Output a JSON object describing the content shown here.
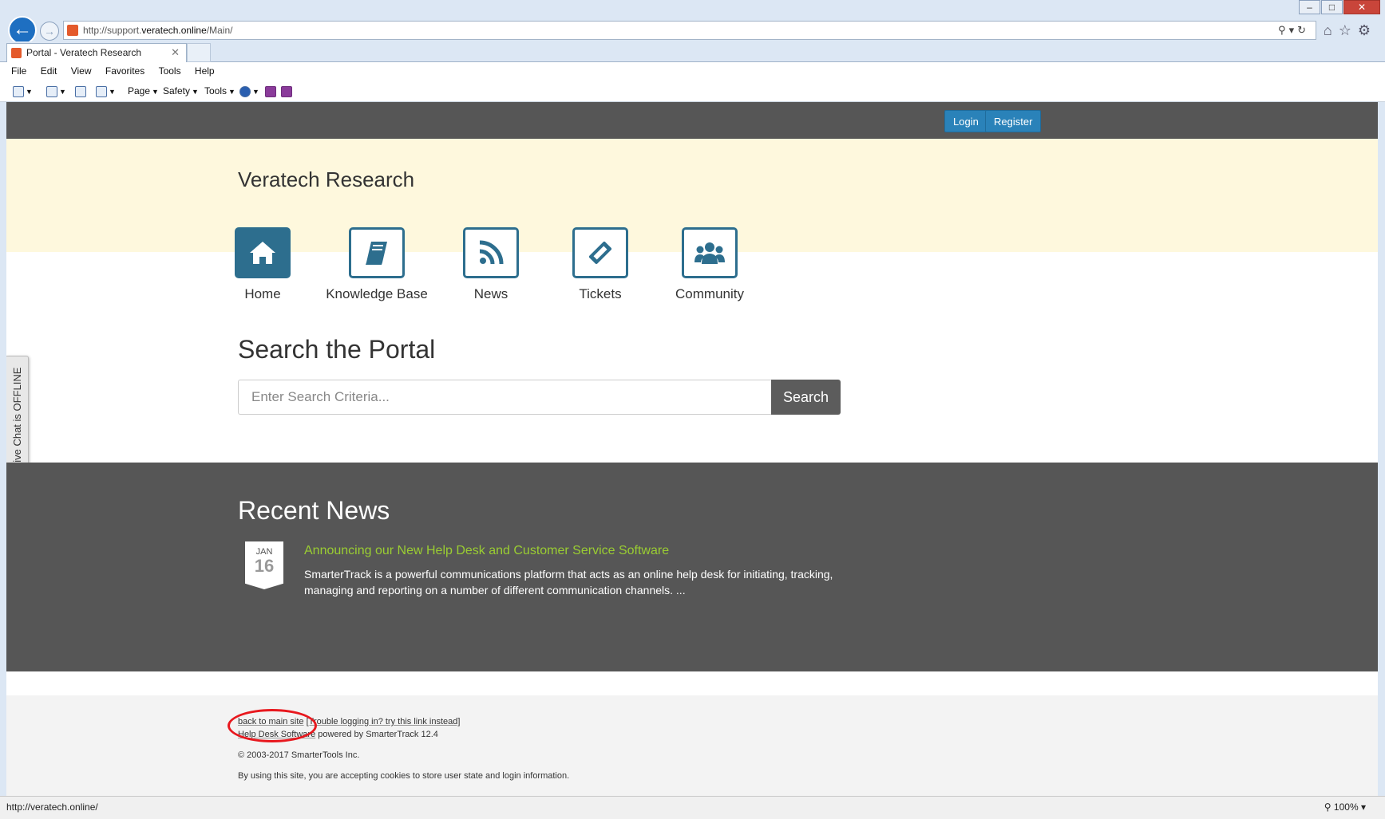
{
  "browser": {
    "url_prefix": "http://support.",
    "url_domain": "veratech.online",
    "url_path": "/Main/",
    "tab_title": "Portal - Veratech Research",
    "menu": [
      "File",
      "Edit",
      "View",
      "Favorites",
      "Tools",
      "Help"
    ],
    "cmd_page": "Page",
    "cmd_safety": "Safety",
    "cmd_tools": "Tools",
    "status_url": "http://veratech.online/",
    "zoom": "100%"
  },
  "header": {
    "login_label": "Login",
    "register_label": "Register"
  },
  "site_title": "Veratech Research",
  "nav_tiles": [
    {
      "label": "Home",
      "icon": "home-icon"
    },
    {
      "label": "Knowledge Base",
      "icon": "book-icon"
    },
    {
      "label": "News",
      "icon": "rss-icon"
    },
    {
      "label": "Tickets",
      "icon": "ticket-icon"
    },
    {
      "label": "Community",
      "icon": "users-icon"
    }
  ],
  "search": {
    "title": "Search the Portal",
    "placeholder": "Enter Search Criteria...",
    "button_label": "Search"
  },
  "live_chat": "Live Chat is OFFLINE",
  "news": {
    "title": "Recent News",
    "item": {
      "month": "JAN",
      "day": "16",
      "headline": "Announcing our New Help Desk and Customer Service Software",
      "summary": "SmarterTrack is a powerful communications platform that acts as an online help desk for initiating, tracking, managing and reporting on a number of different communication channels. ..."
    }
  },
  "footer": {
    "back_link": "back to main site",
    "trouble_link": "[Trouble logging in? try this link instead]",
    "helpdesk_link": "Help Desk Software",
    "powered_by": " powered by SmarterTrack 12.4",
    "copyright": "© 2003-2017 SmarterTools Inc.",
    "cookie_notice": "By using this site, you are accepting cookies to store user state and login information."
  },
  "colors": {
    "header_bg": "#565656",
    "hero_bg": "#fef8dd",
    "accent": "#2d6e8e",
    "link_green": "#9acd32",
    "annotation_red": "#e8181e"
  }
}
